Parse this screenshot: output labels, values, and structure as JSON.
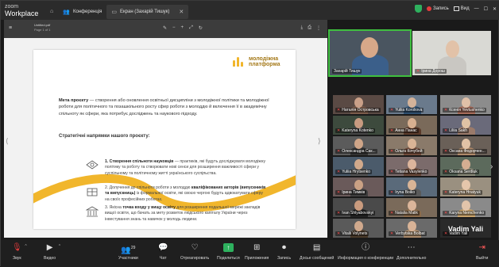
{
  "app": {
    "brand_top": "zoom",
    "brand_bottom": "Workplace"
  },
  "tabs": [
    {
      "icon": "home-icon",
      "label": ""
    },
    {
      "icon": "people-icon",
      "label": "Конференція"
    },
    {
      "icon": "screen-share-icon",
      "label": "Екран (Захарій Тишук)"
    }
  ],
  "topbar": {
    "record_label": "Запись",
    "view_label": "Вид"
  },
  "pdf": {
    "title": "Untitled.pdf",
    "subtitle": "Page 1 of 1"
  },
  "slide": {
    "logo_line1": "молодіжна",
    "logo_line2": "платформа",
    "goal_bold": "Мета проєкту",
    "goal_text": " — створення або оновлення освітньої дисципліни з молодіжної політики та молодіжної роботи для політичного та позашкільного росту сфер роботи з молоддю й включення її в академічну спільноту як сфери, яка потребує досліджень та наукового підходу.",
    "heading": "Стратегічні напрямки нашого проєкту:",
    "item1_bold": "1. Створення спільноти науковців",
    "item1_text": " — практиків, які будуть досліджувати молодіжну політику та роботу та створювати нові сенси для розширення важливості сфери у суспільному та політичному житті українського суспільства.",
    "item2_pre": "2. Долучення до спільноти роботи з молоддю ",
    "item2_bold": "кваліфікованих акторів (випускників та випускниць)",
    "item2_text": " із формальної освіти, які своєю чергою будуть адвокатувати сферу на своїх професійних роботах.",
    "item3_pre": "3. Якісна ",
    "item3_bold": "точка входу у вищу освіту",
    "item3_text": " для розширення подальшої мережі закладів вищої освіти, що бачать за мету розвиток людського капіталу України через інвестування знань та навичок у молодь людини."
  },
  "participants": {
    "speaker": "Захарій Тишук",
    "second": "Ірина Дорош",
    "grid": [
      "Наталія Островська",
      "Yuliia Koroliova",
      "Ксенія Yevtushenko",
      "Kateryna Kotenko",
      "Анна Панас",
      "Liliia Sakh",
      "Олександра Сак...",
      "Ольга Кочубей",
      "Оксана Федорчен...",
      "Yuliia Hrytsenko",
      "Tetiana Vasylenko",
      "Oksana Serdiuk",
      "Ірина Тимків",
      "Iryna Boiko",
      "Kateryna Hnatyuk",
      "Ivan Shlyabovskyi",
      "Natalia Malik",
      "Karyna Nemchenko",
      "Vitalii Volynets",
      "Verbytska Bolbat",
      "Vadim Yali"
    ],
    "big_name": "Vadim Yali"
  },
  "toolbar": {
    "mic": "Звук",
    "video": "Видео",
    "participants": "Участники",
    "participants_count": "29",
    "chat": "Чат",
    "react": "Отреагировать",
    "share": "Поделиться",
    "apps": "Приложения",
    "record": "Запись",
    "docs": "Досье сообщений",
    "info": "Информация о конференции",
    "more": "Дополнительно",
    "leave": "Выйти"
  },
  "colors": {
    "accent_yellow": "#f1b62c",
    "active_green": "#3fbf3f",
    "record_red": "#e43c3c"
  }
}
